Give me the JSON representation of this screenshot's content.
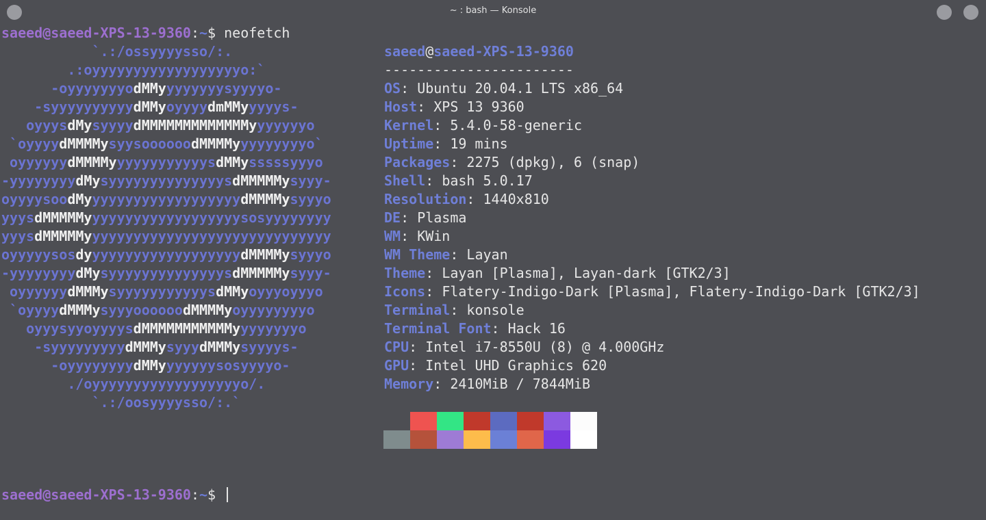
{
  "window": {
    "title": "~ : bash — Konsole"
  },
  "prompt": {
    "user_host": "saeed@saeed-XPS-13-9360",
    "colon": ":",
    "path": "~",
    "symbol": "$ ",
    "command": "neofetch"
  },
  "logo_lines": [
    [
      [
        "b",
        "           `.:/ossyyyysso/:."
      ]
    ],
    [
      [
        "b",
        "        .:oyyyyyyyyyyyyyyyyyyo:`"
      ]
    ],
    [
      [
        "b",
        "      -oyyyyyyyo"
      ],
      [
        "w",
        "dMMy"
      ],
      [
        "b",
        "yyyyyyysyyyyo-"
      ]
    ],
    [
      [
        "b",
        "    -syyyyyyyyyy"
      ],
      [
        "w",
        "dMMy"
      ],
      [
        "b",
        "oyyyy"
      ],
      [
        "w",
        "dmMMy"
      ],
      [
        "b",
        "yyyys-"
      ]
    ],
    [
      [
        "b",
        "   oyyys"
      ],
      [
        "w",
        "dMy"
      ],
      [
        "b",
        "syyyy"
      ],
      [
        "w",
        "dMMMMMMMMMMMMMy"
      ],
      [
        "b",
        "yyyyyyo"
      ]
    ],
    [
      [
        "b",
        " `oyyyy"
      ],
      [
        "w",
        "dMMMMy"
      ],
      [
        "b",
        "syysoooooo"
      ],
      [
        "w",
        "dMMMMy"
      ],
      [
        "b",
        "yyyyyyyyo`"
      ]
    ],
    [
      [
        "b",
        " oyyyyyy"
      ],
      [
        "w",
        "dMMMMy"
      ],
      [
        "b",
        "yyyyyyyyyyys"
      ],
      [
        "w",
        "dMMy"
      ],
      [
        "b",
        "sssssyyyo"
      ]
    ],
    [
      [
        "b",
        "-yyyyyyyy"
      ],
      [
        "w",
        "dMy"
      ],
      [
        "b",
        "syyyyyyyyyyyyyys"
      ],
      [
        "w",
        "dMMMMMy"
      ],
      [
        "b",
        "syyy-"
      ]
    ],
    [
      [
        "b",
        "oyyyysoo"
      ],
      [
        "w",
        "dMy"
      ],
      [
        "b",
        "yyyyyyyyyyyyyyyyyy"
      ],
      [
        "w",
        "dMMMMy"
      ],
      [
        "b",
        "syyyo"
      ]
    ],
    [
      [
        "b",
        "yyys"
      ],
      [
        "w",
        "dMMMMMy"
      ],
      [
        "b",
        "yyyyyyyyyyyyyyyyyysosyyyyyyyy"
      ]
    ],
    [
      [
        "b",
        "yyys"
      ],
      [
        "w",
        "dMMMMMy"
      ],
      [
        "b",
        "yyyyyyyyyyyyyyyyyyyyyyyyyyyyy"
      ]
    ],
    [
      [
        "b",
        "oyyyyysos"
      ],
      [
        "w",
        "dy"
      ],
      [
        "b",
        "yyyyyyyyyyyyyyyyyy"
      ],
      [
        "w",
        "dMMMMy"
      ],
      [
        "b",
        "syyyo"
      ]
    ],
    [
      [
        "b",
        "-yyyyyyyy"
      ],
      [
        "w",
        "dMy"
      ],
      [
        "b",
        "syyyyyyyyyyyyyys"
      ],
      [
        "w",
        "dMMMMMy"
      ],
      [
        "b",
        "syyy-"
      ]
    ],
    [
      [
        "b",
        " oyyyyyy"
      ],
      [
        "w",
        "dMMMy"
      ],
      [
        "b",
        "syyyyyyyyyyys"
      ],
      [
        "w",
        "dMMy"
      ],
      [
        "b",
        "oyyyoyyyo"
      ]
    ],
    [
      [
        "b",
        " `oyyyy"
      ],
      [
        "w",
        "dMMMy"
      ],
      [
        "b",
        "syyyoooooo"
      ],
      [
        "w",
        "dMMMMy"
      ],
      [
        "b",
        "oyyyyyyyyo"
      ]
    ],
    [
      [
        "b",
        "   oyyysyyoyyyys"
      ],
      [
        "w",
        "dMMMMMMMMMMMy"
      ],
      [
        "b",
        "yyyyyyyo"
      ]
    ],
    [
      [
        "b",
        "    -syyyyyyyyy"
      ],
      [
        "w",
        "dMMMy"
      ],
      [
        "b",
        "syyy"
      ],
      [
        "w",
        "dMMMy"
      ],
      [
        "b",
        "syyyys-"
      ]
    ],
    [
      [
        "b",
        "      -oyyyyyyyy"
      ],
      [
        "w",
        "dMMy"
      ],
      [
        "b",
        "yyyyyysosyyyyo-"
      ]
    ],
    [
      [
        "b",
        "        ./oyyyyyyyyyyyyyyyyyyo/."
      ]
    ],
    [
      [
        "b",
        "           `.:/oosyyyysso/:.`"
      ]
    ]
  ],
  "info": {
    "user": "saeed",
    "at": "@",
    "host": "saeed-XPS-13-9360",
    "separator": "-----------------------",
    "rows": [
      {
        "key": "OS",
        "value": "Ubuntu 20.04.1 LTS x86_64"
      },
      {
        "key": "Host",
        "value": "XPS 13 9360"
      },
      {
        "key": "Kernel",
        "value": "5.4.0-58-generic"
      },
      {
        "key": "Uptime",
        "value": "19 mins"
      },
      {
        "key": "Packages",
        "value": "2275 (dpkg), 6 (snap)"
      },
      {
        "key": "Shell",
        "value": "bash 5.0.17"
      },
      {
        "key": "Resolution",
        "value": "1440x810"
      },
      {
        "key": "DE",
        "value": "Plasma"
      },
      {
        "key": "WM",
        "value": "KWin"
      },
      {
        "key": "WM Theme",
        "value": "Layan"
      },
      {
        "key": "Theme",
        "value": "Layan [Plasma], Layan-dark [GTK2/3]"
      },
      {
        "key": "Icons",
        "value": "Flatery-Indigo-Dark [Plasma], Flatery-Indigo-Dark [GTK2/3]"
      },
      {
        "key": "Terminal",
        "value": "konsole"
      },
      {
        "key": "Terminal Font",
        "value": "Hack 16"
      },
      {
        "key": "CPU",
        "value": "Intel i7-8550U (8) @ 4.000GHz"
      },
      {
        "key": "GPU",
        "value": "Intel UHD Graphics 620"
      },
      {
        "key": "Memory",
        "value": "2410MiB / 7844MiB"
      }
    ]
  },
  "palette": {
    "row1": [
      "#4d4e53",
      "#ef5350",
      "#33e585",
      "#c0392b",
      "#5c6bc0",
      "#c0392b",
      "#8c5ae0",
      "#fcfcfc"
    ],
    "row2": [
      "#7f8c8d",
      "#b5523b",
      "#9e7bd5",
      "#fdbc4b",
      "#6b80d6",
      "#e0664a",
      "#7b3ae0",
      "#ffffff"
    ]
  }
}
